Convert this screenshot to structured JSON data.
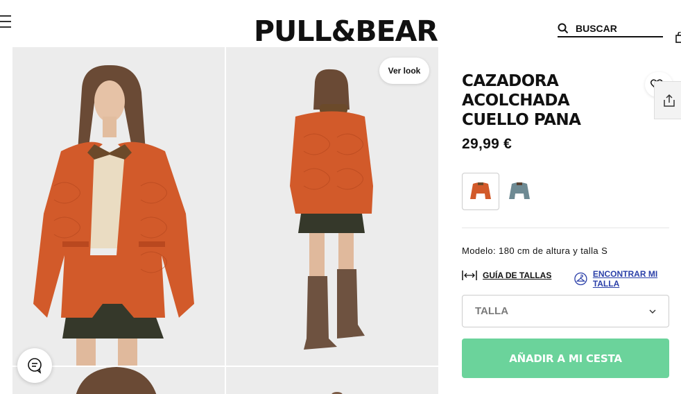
{
  "header": {
    "logo": "PULL&BEAR",
    "search_placeholder": "BUSCAR",
    "menu_icon": "hamburger-icon",
    "search_icon": "search-icon",
    "bag_icon": "shopping-bag-icon"
  },
  "gallery": {
    "ver_look_label": "Ver look",
    "chat_icon": "chat-icon",
    "jacket_color": "#d25a2a"
  },
  "product": {
    "title": "CAZADORA ACOLCHADA CUELLO PANA",
    "price": "29,99 €",
    "colors": [
      {
        "name": "naranja",
        "hex": "#d25a2a",
        "selected": true
      },
      {
        "name": "azul grisáceo",
        "hex": "#6e8a93",
        "selected": false
      }
    ],
    "model_info": "Modelo: 180 cm de altura y talla S",
    "size_guide_label": "GUÍA DE TALLAS",
    "find_size_label": "ENCONTRAR MI TALLA",
    "size_select_label": "TALLA",
    "add_to_cart_label": "AÑADIR A MI CESTA",
    "add_to_cart_color": "#6bd39b",
    "link_color": "#2a3fa8"
  }
}
